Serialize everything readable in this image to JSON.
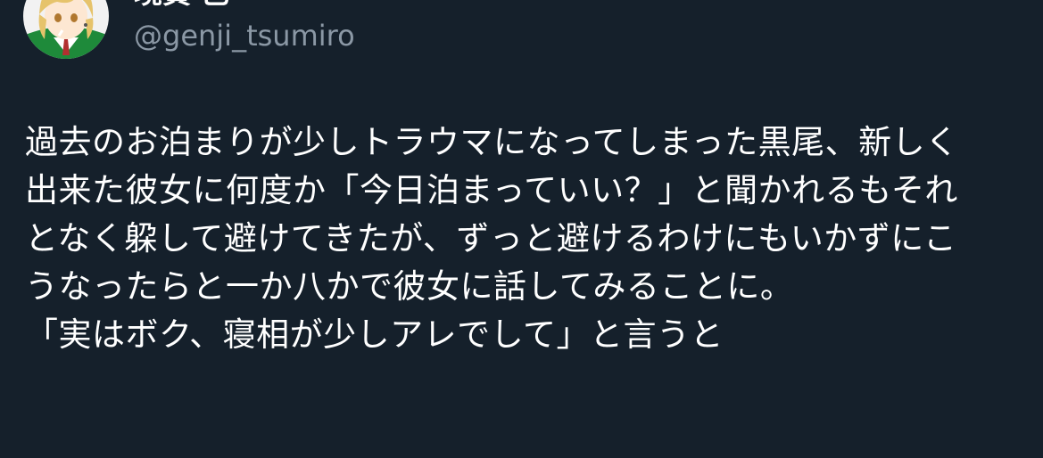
{
  "tweet": {
    "display_name": "境賀 己",
    "handle": "@genji_tsumiro",
    "lines": [
      "過去のお泊まりが少しトラウマになってしまった黒尾、新しく",
      "出来た彼女に何度か「今日泊まっていい？」と聞かれるもそれ",
      "となく躱して避けてきたが、ずっと避けるわけにもいかずにこ",
      "うなったらと一か八かで彼女に話してみることに。",
      "「実はボク、寝相が少しアレでして」と言うと"
    ]
  },
  "colors": {
    "background": "#15202b",
    "text": "#ffffff",
    "handle": "#8b98a5"
  }
}
